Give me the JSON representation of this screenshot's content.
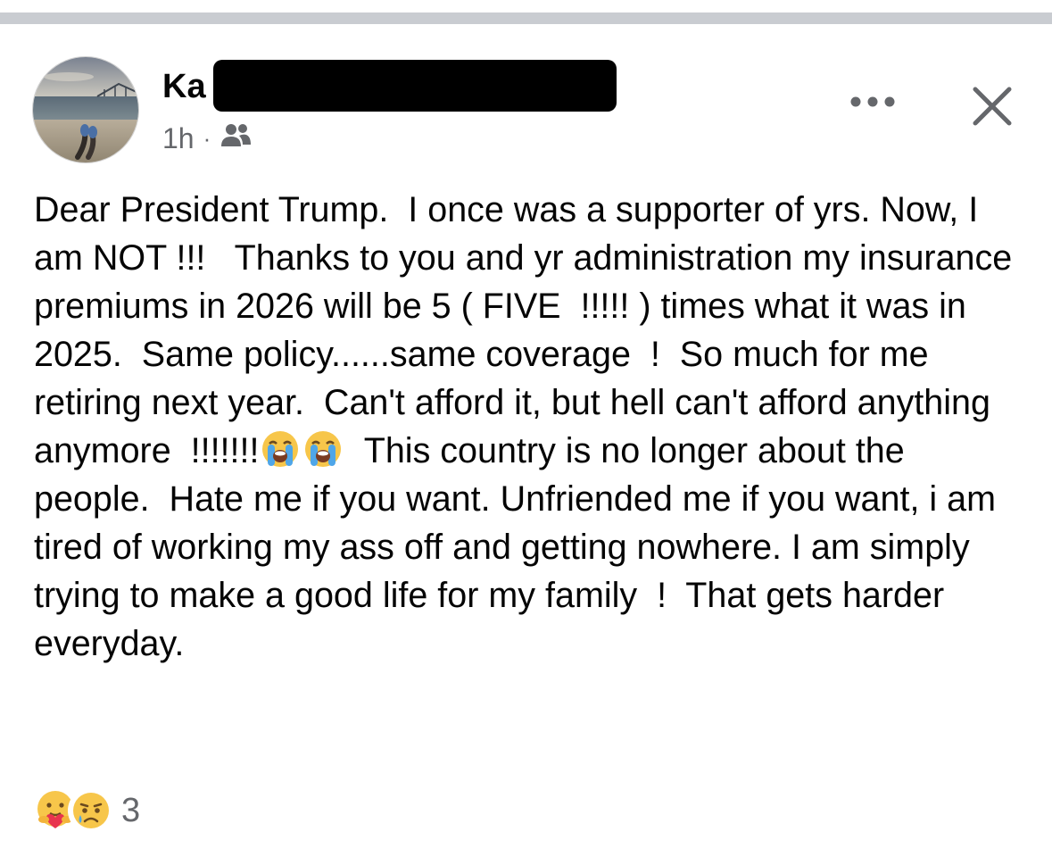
{
  "post": {
    "author_name_visible": "Ka",
    "timestamp": "1h",
    "meta_separator": "·",
    "audience_icon": "friends-icon",
    "more_icon": "more-horizontal-icon",
    "close_icon": "close-icon",
    "body_segments": [
      "Dear President Trump.  I once was a supporter of yrs. Now, I am NOT !!!   Thanks to you and yr administration my insurance premiums in 2026 will be 5 ( FIVE  !!!!! ) times what it was in 2025.  Same policy......same coverage  !  So much for me retiring next year.  Can't afford it, but hell can't afford anything anymore  !!!!!!!",
      "This country is no longer about the people.  Hate me if you want. Unfriended me if you want, i am tired of working my ass off and getting nowhere. I am simply trying to make a good life for my family  !  That gets harder everyday."
    ],
    "inline_emojis": [
      "loudly-crying-face-emoji",
      "loudly-crying-face-emoji"
    ],
    "reactions": {
      "icons": [
        "care-reaction-icon",
        "sad-reaction-icon"
      ],
      "count": "3"
    }
  },
  "colors": {
    "text": "#050505",
    "secondary_text": "#65676b",
    "divider": "#c9ccd1",
    "redaction": "#000000"
  }
}
